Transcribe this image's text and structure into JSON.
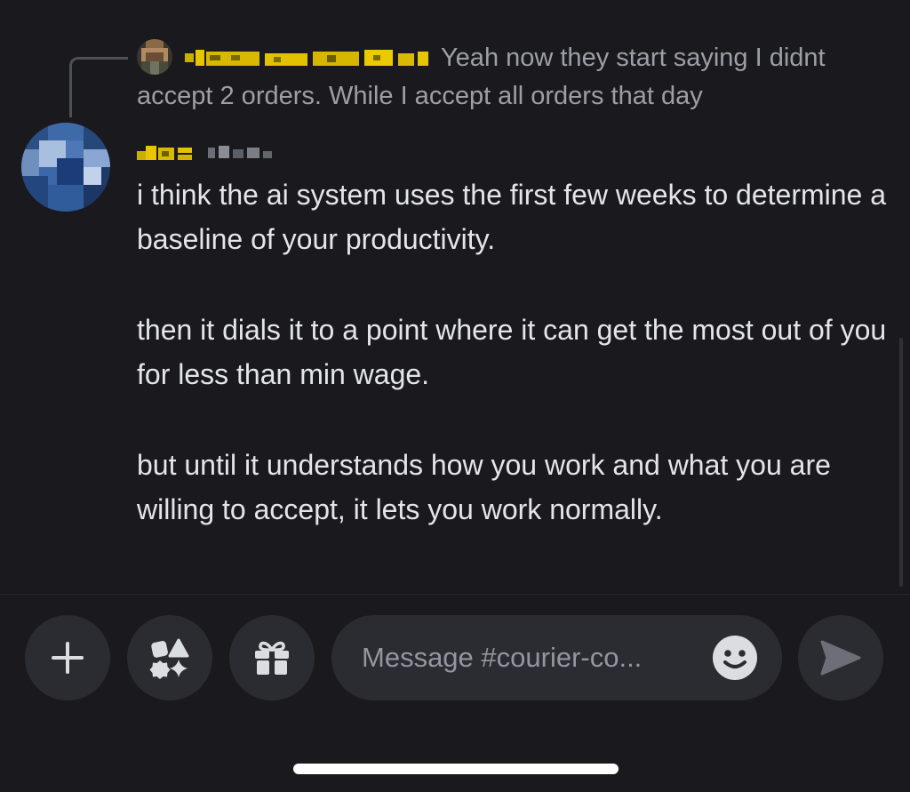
{
  "reply_preview": {
    "text": "Yeah now they start saying I didnt accept 2 orders. While I accept all orders that day"
  },
  "message": {
    "paragraphs": [
      "i think the ai system uses the first few weeks to determine a baseline of your productivity.",
      "then it dials it to a point where it can get the most out of you for less than min wage.",
      "but until it understands how you work and what you are willing to accept, it lets you work normally."
    ]
  },
  "composer": {
    "placeholder": "Message #courier-co...",
    "icons": {
      "attach": "plus-icon",
      "apps": "apps-icon",
      "gift": "gift-icon",
      "emoji": "emoji-icon",
      "send": "send-icon"
    }
  },
  "colors": {
    "background": "#1a1a1e",
    "button_bg": "#2b2c31",
    "text_primary": "#e3e5e8",
    "text_muted": "#9c9fa6",
    "username_censored": "#e8c500"
  }
}
